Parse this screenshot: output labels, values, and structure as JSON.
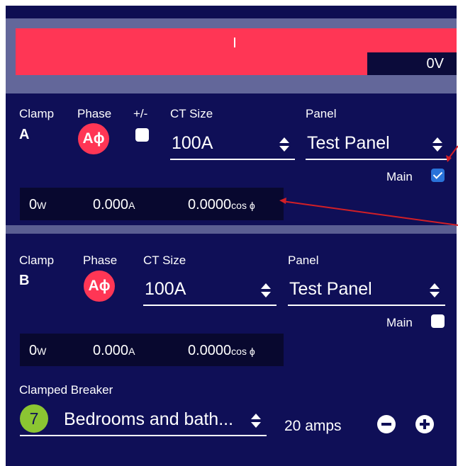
{
  "voltage": {
    "readout": "0V",
    "colors": {
      "bar": "#ff3655"
    }
  },
  "clamp_a": {
    "clamp_label": "Clamp",
    "clamp_letter": "A",
    "phase_label": "Phase",
    "phase_value": "Aϕ",
    "sign_label": "+/-",
    "ct_size_label": "CT Size",
    "ct_size_value": "100A",
    "panel_label": "Panel",
    "panel_value": "Test Panel",
    "main_label": "Main",
    "main_checked": true,
    "readings": {
      "watts": "0",
      "watts_unit": "W",
      "amps": "0.000",
      "amps_unit": "A",
      "pf": "0.0000",
      "pf_unit": "cos ϕ"
    }
  },
  "clamp_b": {
    "clamp_label": "Clamp",
    "clamp_letter": "B",
    "phase_label": "Phase",
    "phase_value": "Aϕ",
    "ct_size_label": "CT Size",
    "ct_size_value": "100A",
    "panel_label": "Panel",
    "panel_value": "Test Panel",
    "main_label": "Main",
    "main_checked": false,
    "readings": {
      "watts": "0",
      "watts_unit": "W",
      "amps": "0.000",
      "amps_unit": "A",
      "pf": "0.0000",
      "pf_unit": "cos ϕ"
    }
  },
  "breaker": {
    "label": "Clamped Breaker",
    "number": "7",
    "name": "Bedrooms and bath...",
    "amps": "20 amps",
    "icons": {
      "decrease": "minus-circle-icon",
      "increase": "plus-circle-icon"
    }
  },
  "colors": {
    "background": "#0f0f57",
    "accent": "#ff3655",
    "badge": "#8bc532",
    "checked": "#2a73d9"
  }
}
